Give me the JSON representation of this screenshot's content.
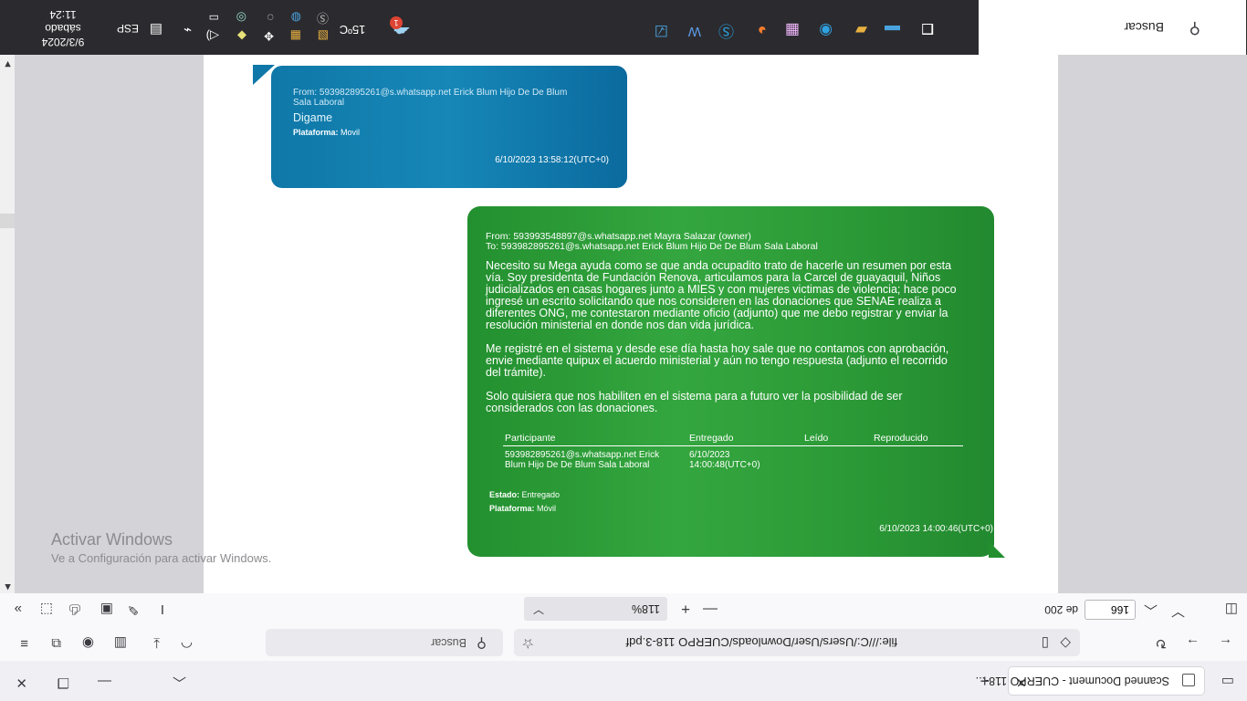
{
  "browser": {
    "tab_title": "Scanned Document - CUERPO 118-...",
    "url": "file:///C:/Users/User/Downloads/CUERPO 118-3.pdf",
    "search_placeholder": "Buscar"
  },
  "pdf_toolbar": {
    "page_number": "166",
    "page_total": "de 200",
    "zoom": "118%"
  },
  "watermark": {
    "title": "Activar Windows",
    "subtitle": "Ve a Configuración para activar Windows."
  },
  "taskbar": {
    "search_label": "Buscar",
    "temperature": "15ºC",
    "weather_badge": "1",
    "language": "ESP",
    "time": "11:24",
    "day": "sábado",
    "date": "9/3/2024"
  },
  "message_top": {
    "from_line": "From: 593982895261@s.whatsapp.net Erick Blum Hijo De De Blum",
    "from_line2": "Sala Laboral",
    "body": "Digame",
    "platform_label": "Plataforma:",
    "platform_value": "Movil",
    "timestamp": "6/10/2023 13:58:12(UTC+0)"
  },
  "message_main": {
    "from": "From: 593993548897@s.whatsapp.net Mayra Salazar (owner)",
    "to": "To: 593982895261@s.whatsapp.net Erick Blum Hijo De De Blum Sala Laboral",
    "para1": "Necesito su Mega ayuda  como se que anda ocupadito trato de hacerle un resumen por esta vía. Soy presidenta de Fundación Renova, articulamos para la Carcel de guayaquil, Niños judicializados en casas hogares junto a MIES y con mujeres victimas de violencia; hace poco ingresé un escrito solicitando que nos consideren en las donaciones que SENAE realiza a diferentes ONG, me contestaron mediante oficio (adjunto) que me debo registrar y enviar la resolución ministerial en donde nos dan vida jurídica.",
    "para2": "Me registré en el sistema y desde ese día hasta hoy sale que no contamos con aprobación, envie mediante quipux el acuerdo ministerial y aún no tengo respuesta  (adjunto el recorrido del trámite).",
    "para3": "Solo quisiera que nos habiliten en el sistema para a futuro ver la posibilidad de ser considerados con las donaciones.",
    "table_headers": [
      "Participante",
      "Entregado",
      "Leído",
      "Reproducido"
    ],
    "table_row": {
      "participant": "593982895261@s.whatsapp.net Erick Blum Hijo De De Blum Sala Laboral",
      "delivered": "6/10/2023 14:00:48(UTC+0)",
      "read": "",
      "played": ""
    },
    "status_label": "Estado:",
    "status_value": "Entregado",
    "platform_label": "Plataforma:",
    "platform_value": "Móvil",
    "timestamp": "6/10/2023 14:00:46(UTC+0)"
  }
}
